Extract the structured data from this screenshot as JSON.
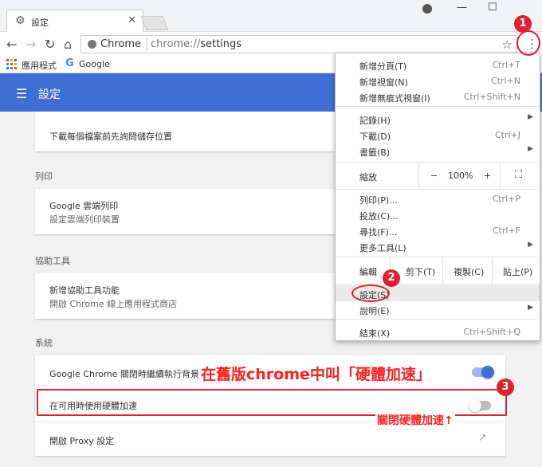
{
  "tab": {
    "title": "設定",
    "close": "✕"
  },
  "window_controls": {
    "minimize": "—",
    "maximize": "☐",
    "close": "✕"
  },
  "omnibox": {
    "site_chip": "Chrome",
    "url_prefix": "chrome://",
    "url_path": "settings"
  },
  "bookmarks": {
    "apps_label": "應用程式",
    "google_label": "Google"
  },
  "header": {
    "title": "設定"
  },
  "page": {
    "download_row": "下載每個檔案前先詢問儲存位置",
    "print_section": "列印",
    "cloud_print_title": "Google 雲端列印",
    "cloud_print_sub": "設定雲端列印裝置",
    "a11y_section": "協助工具",
    "a11y_title": "新增協助工具功能",
    "a11y_sub": "開啟 Chrome 線上應用程式商店",
    "system_section": "系統",
    "background_apps": "Google Chrome 關閉時繼續執行背景應用程式",
    "hardware_accel": "在可用時使用硬體加速",
    "proxy": "開啟 Proxy 設定",
    "background_apps_enabled": true,
    "hardware_accel_enabled": false
  },
  "menu": {
    "new_tab": "新增分頁(T)",
    "new_tab_sc": "Ctrl+T",
    "new_window": "新增視窗(N)",
    "new_window_sc": "Ctrl+N",
    "incognito": "新增無痕式視窗(I)",
    "incognito_sc": "Ctrl+Shift+N",
    "history": "記錄(H)",
    "downloads": "下載(D)",
    "downloads_sc": "Ctrl+J",
    "bookmarks": "書籤(B)",
    "zoom": "縮放",
    "zoom_minus": "−",
    "zoom_value": "100%",
    "zoom_plus": "+",
    "print": "列印(P)...",
    "print_sc": "Ctrl+P",
    "cast": "投放(C)...",
    "find": "尋找(F)...",
    "find_sc": "Ctrl+F",
    "more_tools": "更多工具(L)",
    "edit": "編輯",
    "cut": "剪下(T)",
    "copy": "複製(C)",
    "paste": "貼上(P)",
    "settings": "設定(S)",
    "help": "說明(E)",
    "exit": "結束(X)",
    "exit_sc": "Ctrl+Shift+Q"
  },
  "annotations": {
    "badge1": "1",
    "badge2": "2",
    "badge3": "3",
    "old_name": "在舊版chrome中叫「硬體加速」",
    "turn_off": "關閉硬體加速↑",
    "accent_color": "#e0202f"
  },
  "colors": {
    "header_bg": "#3f6fd4",
    "toggle_on": "#3f6fd4"
  }
}
